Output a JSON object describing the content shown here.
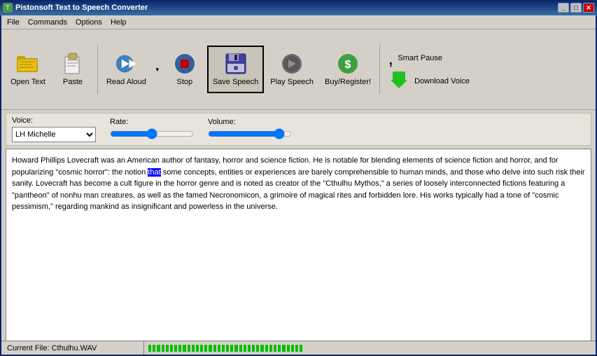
{
  "title": {
    "text": "Pistonsoft Text to Speech Converter",
    "icon": "T"
  },
  "title_buttons": {
    "minimize": "_",
    "maximize": "□",
    "close": "✕"
  },
  "menu": {
    "items": [
      "File",
      "Commands",
      "Options",
      "Help"
    ]
  },
  "toolbar": {
    "open_label": "Open Text",
    "paste_label": "Paste",
    "read_aloud_label": "Read Aloud",
    "stop_label": "Stop",
    "save_speech_label": "Save Speech",
    "play_speech_label": "Play Speech",
    "buy_label": "Buy/Register!",
    "smart_pause_label": "Smart Pause",
    "download_voice_label": "Download Voice"
  },
  "controls": {
    "voice_label": "Voice:",
    "voice_value": "LH Michelle",
    "rate_label": "Rate:",
    "volume_label": "Volume:",
    "rate_value": 50,
    "volume_value": 90
  },
  "text_content": {
    "body": " Howard Phillips Lovecraft was an American author of fantasy, horror and science fiction. He is notable for blending elements of science fiction and horror, and for popularizing \"cosmic horror\": the notion that some concepts, entities or experiences are barely comprehensible to human minds, and those who delve into such risk their sanity. Lovecraft has become a cult figure in the horror genre and is noted as creator of the \"Cthulhu Mythos,\" a series of loosely interconnected fictions featuring a \"pantheon\" of nonhu man creatures, as well as the famed Necronomicon, a grimoire of magical rites and forbidden lore. His works typically had a tone of \"cosmic pessimism,\" regarding mankind as insignificant and powerless in the universe.",
    "highlight_word": "that"
  },
  "status": {
    "file_label": "Current File: Cthulhu.WAV",
    "progress_segments": 36
  }
}
